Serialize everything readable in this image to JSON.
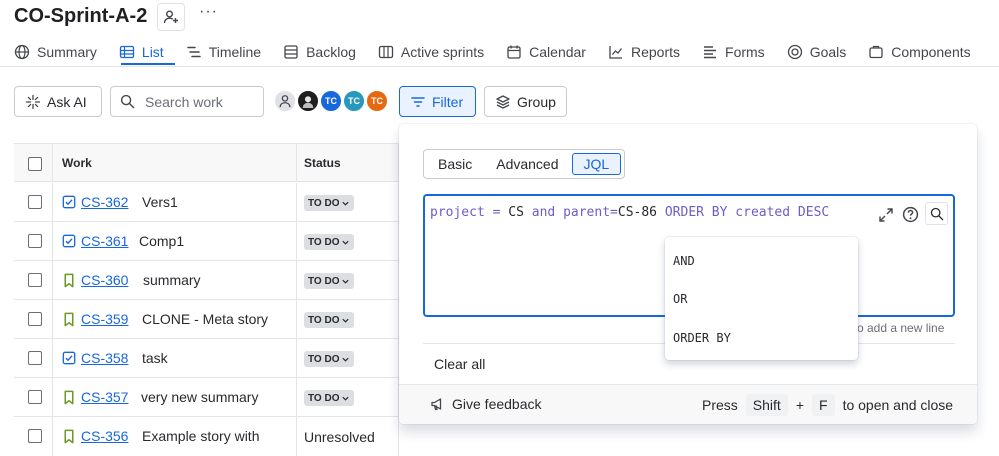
{
  "header": {
    "title": "CO-Sprint-A-2",
    "more": "···"
  },
  "tabs": [
    {
      "label": "Summary",
      "icon": "globe-icon"
    },
    {
      "label": "List",
      "icon": "list-icon",
      "active": true
    },
    {
      "label": "Timeline",
      "icon": "timeline-icon"
    },
    {
      "label": "Backlog",
      "icon": "backlog-icon"
    },
    {
      "label": "Active sprints",
      "icon": "board-icon"
    },
    {
      "label": "Calendar",
      "icon": "calendar-icon"
    },
    {
      "label": "Reports",
      "icon": "chart-icon"
    },
    {
      "label": "Forms",
      "icon": "forms-icon"
    },
    {
      "label": "Goals",
      "icon": "goal-icon"
    },
    {
      "label": "Components",
      "icon": "component-icon"
    }
  ],
  "toolbar": {
    "ask_ai": "Ask AI",
    "search_placeholder": "Search work",
    "filter": "Filter",
    "group": "Group",
    "avatars": [
      "TC",
      "TC",
      "TC"
    ]
  },
  "table": {
    "headers": {
      "work": "Work",
      "status": "Status"
    },
    "rows": [
      {
        "key": "CS-362",
        "summary": "Vers1",
        "type": "task",
        "status": "TO DO"
      },
      {
        "key": "CS-361",
        "summary": "Comp1",
        "type": "task",
        "status": "TO DO"
      },
      {
        "key": "CS-360",
        "summary": "summary",
        "type": "story",
        "status": "TO DO"
      },
      {
        "key": "CS-359",
        "summary": "CLONE - Meta story",
        "type": "story",
        "status": "TO DO"
      },
      {
        "key": "CS-358",
        "summary": "task",
        "type": "task",
        "status": "TO DO"
      },
      {
        "key": "CS-357",
        "summary": "very new summary",
        "type": "story",
        "status": "TO DO"
      },
      {
        "key": "CS-356",
        "summary": "Example story with",
        "type": "story",
        "status": "Unresolved"
      }
    ]
  },
  "filter_popup": {
    "modes": [
      "Basic",
      "Advanced",
      "JQL"
    ],
    "active_mode": "JQL",
    "query_tokens": {
      "t1": "project",
      "t2": " = ",
      "t3": "CS",
      "t4": " and ",
      "t5": "parent",
      "t6": "=",
      "t7": "CS-86",
      "t8": " ORDER BY ",
      "t9": "created",
      "t10": " DESC"
    },
    "hint_fragment": "o add a new line",
    "suggestions": [
      "AND",
      "OR",
      "ORDER BY"
    ],
    "clear_all": "Clear all",
    "feedback": "Give feedback",
    "shortcut": {
      "press": "Press",
      "key1": "Shift",
      "plus": "+",
      "key2": "F",
      "suffix": "to open and close"
    }
  },
  "colors": {
    "accent": "#1868db",
    "keyword": "#6e5dc6",
    "story_icon": "#6a9a23",
    "task_icon": "#1868db"
  }
}
